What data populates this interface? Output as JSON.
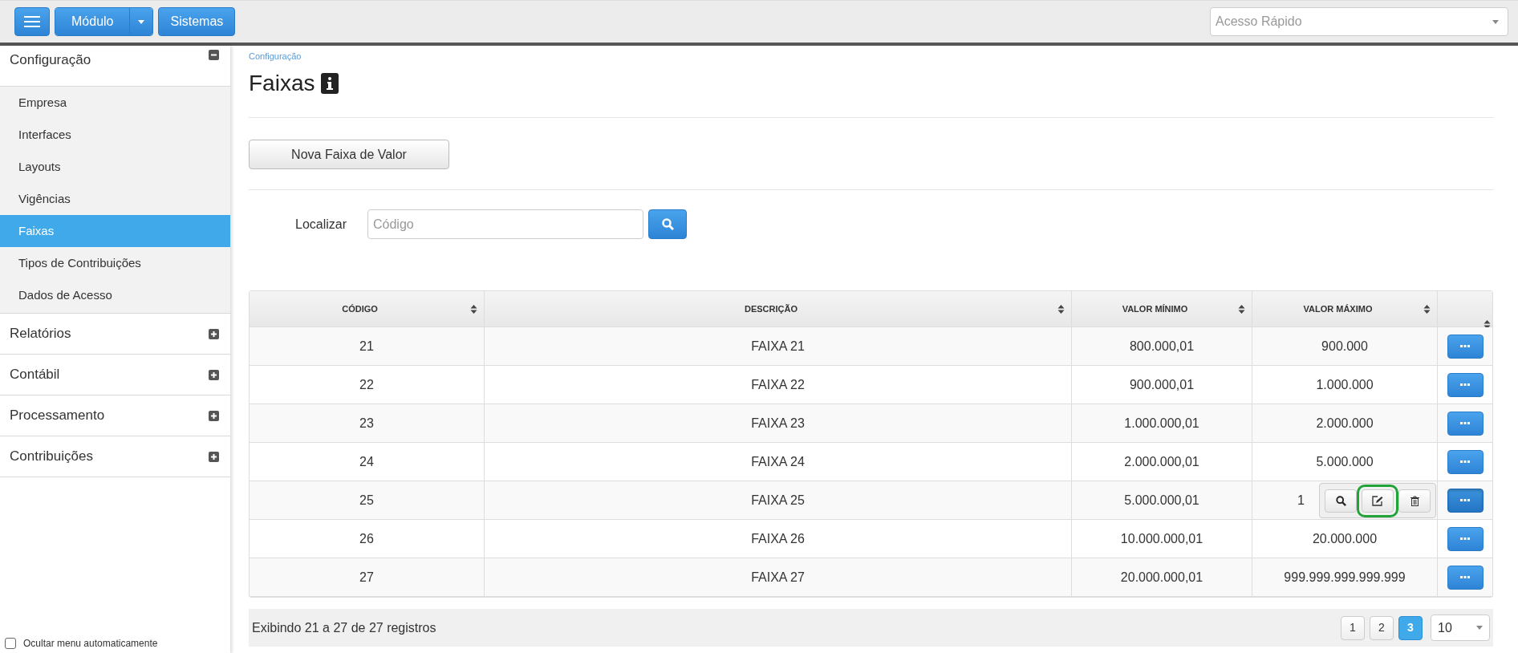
{
  "top_bar": {
    "module_button": "Módulo",
    "systems_button": "Sistemas",
    "quick_access": {
      "placeholder": "Acesso Rápido"
    }
  },
  "sidebar": {
    "sections": [
      {
        "label": "Configuração",
        "expanded": true,
        "children": [
          {
            "label": "Empresa",
            "selected": false
          },
          {
            "label": "Interfaces",
            "selected": false
          },
          {
            "label": "Layouts",
            "selected": false
          },
          {
            "label": "Vigências",
            "selected": false
          },
          {
            "label": "Faixas",
            "selected": true
          },
          {
            "label": "Tipos de Contribuições",
            "selected": false
          },
          {
            "label": "Dados de Acesso",
            "selected": false
          }
        ]
      },
      {
        "label": "Relatórios",
        "expanded": false
      },
      {
        "label": "Contábil",
        "expanded": false
      },
      {
        "label": "Processamento",
        "expanded": false
      },
      {
        "label": "Contribuições",
        "expanded": false
      }
    ],
    "auto_hide": {
      "label": "Ocultar menu automaticamente",
      "checked": false
    }
  },
  "breadcrumb": "Configuração",
  "title": "Faixas",
  "new_button": "Nova Faixa de Valor",
  "search": {
    "label": "Localizar",
    "placeholder": "Código"
  },
  "table": {
    "columns": [
      "CÓDIGO",
      "DESCRIÇÃO",
      "VALOR MÍNIMO",
      "VALOR MÁXIMO"
    ],
    "rows": [
      {
        "cells": [
          "21",
          "FAIXA 21",
          "800.000,01",
          "900.000"
        ],
        "menu_open": false
      },
      {
        "cells": [
          "22",
          "FAIXA 22",
          "900.000,01",
          "1.000.000"
        ],
        "menu_open": false
      },
      {
        "cells": [
          "23",
          "FAIXA 23",
          "1.000.000,01",
          "2.000.000"
        ],
        "menu_open": false
      },
      {
        "cells": [
          "24",
          "FAIXA 24",
          "2.000.000,01",
          "5.000.000"
        ],
        "menu_open": false
      },
      {
        "cells": [
          "25",
          "FAIXA 25",
          "5.000.000,01",
          "1"
        ],
        "menu_open": true,
        "actions": [
          {
            "kind": "view",
            "highlighted": false
          },
          {
            "kind": "edit",
            "highlighted": true
          },
          {
            "kind": "delete",
            "highlighted": false
          }
        ]
      },
      {
        "cells": [
          "26",
          "FAIXA 26",
          "10.000.000,01",
          "20.000.000"
        ],
        "menu_open": false
      },
      {
        "cells": [
          "27",
          "FAIXA 27",
          "20.000.000,01",
          "999.999.999.999.999"
        ],
        "menu_open": false
      }
    ]
  },
  "footer": {
    "summary": "Exibindo 21 a 27 de 27 registros",
    "pages": [
      {
        "label": "1",
        "selected": false
      },
      {
        "label": "2",
        "selected": false
      },
      {
        "label": "3",
        "selected": true
      }
    ],
    "page_size": "10"
  }
}
